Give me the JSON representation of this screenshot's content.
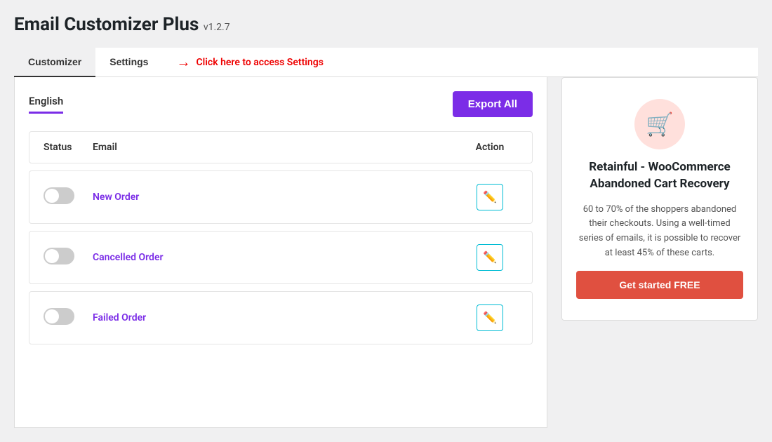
{
  "page": {
    "title": "Email Customizer Plus",
    "version": "v1.2.7"
  },
  "tabs": [
    {
      "id": "customizer",
      "label": "Customizer",
      "active": true
    },
    {
      "id": "settings",
      "label": "Settings",
      "active": false
    }
  ],
  "settings_hint": "Click here to access Settings",
  "lang_tab": {
    "label": "English"
  },
  "export_all_btn": "Export All",
  "table": {
    "headers": {
      "status": "Status",
      "email": "Email",
      "action": "Action"
    },
    "rows": [
      {
        "id": "new-order",
        "status": "off",
        "name": "New Order"
      },
      {
        "id": "cancelled-order",
        "status": "off",
        "name": "Cancelled Order"
      },
      {
        "id": "failed-order",
        "status": "off",
        "name": "Failed Order"
      }
    ]
  },
  "sidebar": {
    "icon": "🛒",
    "title": "Retainful - WooCommerce Abandoned Cart Recovery",
    "description": "60 to 70% of the shoppers abandoned their checkouts. Using a well-timed series of emails, it is possible to recover at least 45% of these carts.",
    "cta_label": "Get started FREE"
  }
}
